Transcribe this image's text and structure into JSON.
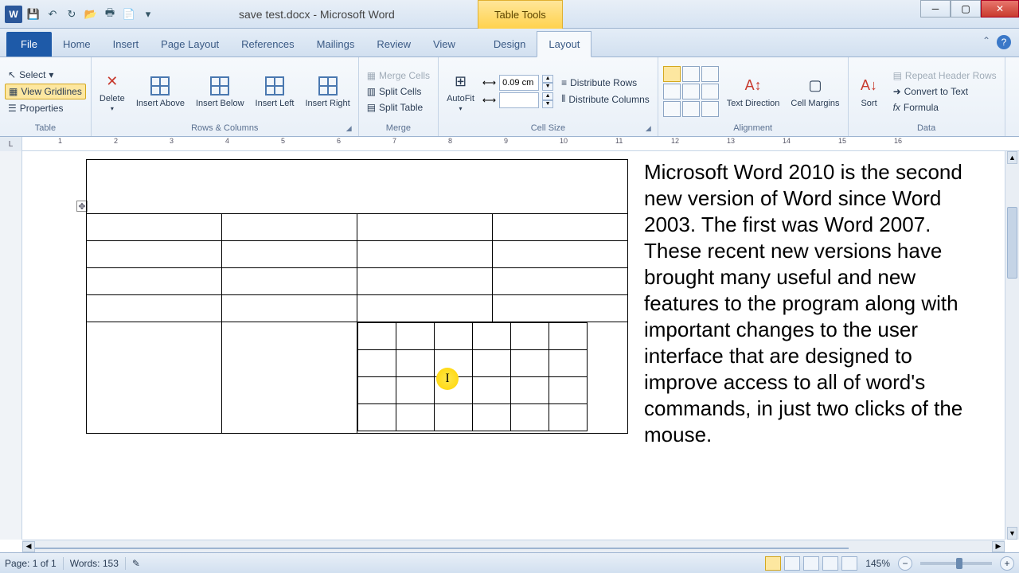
{
  "titlebar": {
    "doc_title": "save test.docx - Microsoft Word",
    "table_tools": "Table Tools"
  },
  "tabs": {
    "file": "File",
    "items": [
      "Home",
      "Insert",
      "Page Layout",
      "References",
      "Mailings",
      "Review",
      "View"
    ],
    "context": [
      "Design",
      "Layout"
    ],
    "active": "Layout"
  },
  "ribbon": {
    "table": {
      "label": "Table",
      "select": "Select",
      "view_gridlines": "View Gridlines",
      "properties": "Properties"
    },
    "rows_cols": {
      "label": "Rows & Columns",
      "delete": "Delete",
      "insert_above": "Insert Above",
      "insert_below": "Insert Below",
      "insert_left": "Insert Left",
      "insert_right": "Insert Right"
    },
    "merge": {
      "label": "Merge",
      "merge_cells": "Merge Cells",
      "split_cells": "Split Cells",
      "split_table": "Split Table"
    },
    "cell_size": {
      "label": "Cell Size",
      "autofit": "AutoFit",
      "height_value": "0.09 cm",
      "width_value": "",
      "dist_rows": "Distribute Rows",
      "dist_cols": "Distribute Columns"
    },
    "alignment": {
      "label": "Alignment",
      "text_direction": "Text Direction",
      "cell_margins": "Cell Margins"
    },
    "data": {
      "label": "Data",
      "sort": "Sort",
      "repeat_header": "Repeat Header Rows",
      "convert_text": "Convert to Text",
      "formula": "Formula"
    }
  },
  "ruler": {
    "corner": "L",
    "numbers": [
      "1",
      "2",
      "3",
      "4",
      "5",
      "6",
      "7",
      "8",
      "9",
      "10",
      "11",
      "12",
      "13",
      "14",
      "15",
      "16"
    ]
  },
  "document": {
    "body_text": "Microsoft Word 2010 is the second new version of Word since Word 2003. The first was Word 2007. These recent new versions have brought many useful and new features to the program along with important changes to the user interface that are designed to improve access to all of word's commands, in just two clicks of the mouse."
  },
  "statusbar": {
    "page": "Page: 1 of 1",
    "words": "Words: 153",
    "zoom": "145%"
  }
}
